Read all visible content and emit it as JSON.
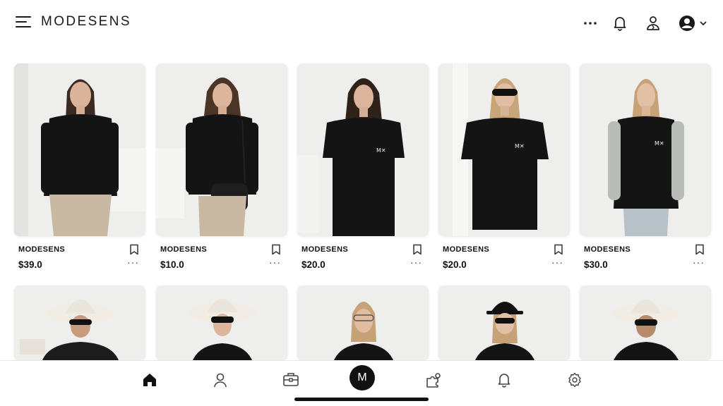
{
  "header": {
    "brand": "MODESENS",
    "icons": [
      "menu-icon",
      "more-horizontal-icon",
      "bell-icon",
      "user-icon",
      "account-circle-icon",
      "chevron-down-icon"
    ],
    "more_label": "···"
  },
  "products": [
    {
      "brand": "MODESENS",
      "price": "$39.0",
      "more": "···"
    },
    {
      "brand": "MODESENS",
      "price": "$10.0",
      "more": "···"
    },
    {
      "brand": "MODESENS",
      "price": "$20.0",
      "more": "···"
    },
    {
      "brand": "MODESENS",
      "price": "$20.0",
      "more": "···"
    },
    {
      "brand": "MODESENS",
      "price": "$30.0",
      "more": "···"
    }
  ],
  "bottom_nav": {
    "items": [
      "home-icon",
      "profile-icon",
      "wardrobe-icon",
      "modesens-center",
      "puzzle-icon",
      "bell-icon",
      "settings-icon"
    ],
    "center_label": "M"
  },
  "colors": {
    "background": "#ffffff",
    "text": "#111111",
    "photo_bg": "#ececea",
    "accent": "#111111"
  }
}
